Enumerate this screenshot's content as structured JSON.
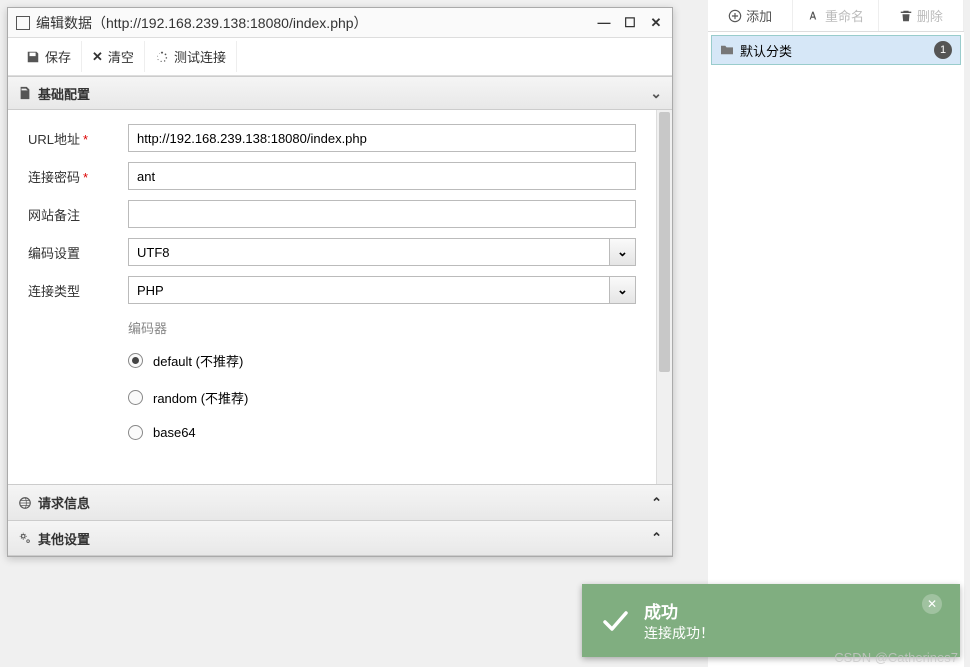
{
  "window": {
    "title": "编辑数据（http://192.168.239.138:18080/index.php）"
  },
  "toolbar": {
    "save": "保存",
    "clear": "清空",
    "test": "测试连接"
  },
  "panels": {
    "basic": "基础配置",
    "request": "请求信息",
    "other": "其他设置"
  },
  "form": {
    "url": {
      "label": "URL地址",
      "value": "http://192.168.239.138:18080/index.php",
      "required": "*"
    },
    "password": {
      "label": "连接密码",
      "value": "ant",
      "required": "*"
    },
    "note": {
      "label": "网站备注",
      "value": ""
    },
    "encoding": {
      "label": "编码设置",
      "value": "UTF8"
    },
    "type": {
      "label": "连接类型",
      "value": "PHP"
    },
    "encoder": {
      "label": "编码器",
      "options": [
        {
          "label": "default (不推荐)",
          "checked": true
        },
        {
          "label": "random (不推荐)",
          "checked": false
        },
        {
          "label": "base64",
          "checked": false
        }
      ]
    }
  },
  "sidebar": {
    "add": "添加",
    "rename": "重命名",
    "delete": "删除",
    "category": {
      "name": "默认分类",
      "count": "1"
    }
  },
  "toast": {
    "title": "成功",
    "message": "连接成功！"
  },
  "watermark": "CSDN @Catherines7"
}
